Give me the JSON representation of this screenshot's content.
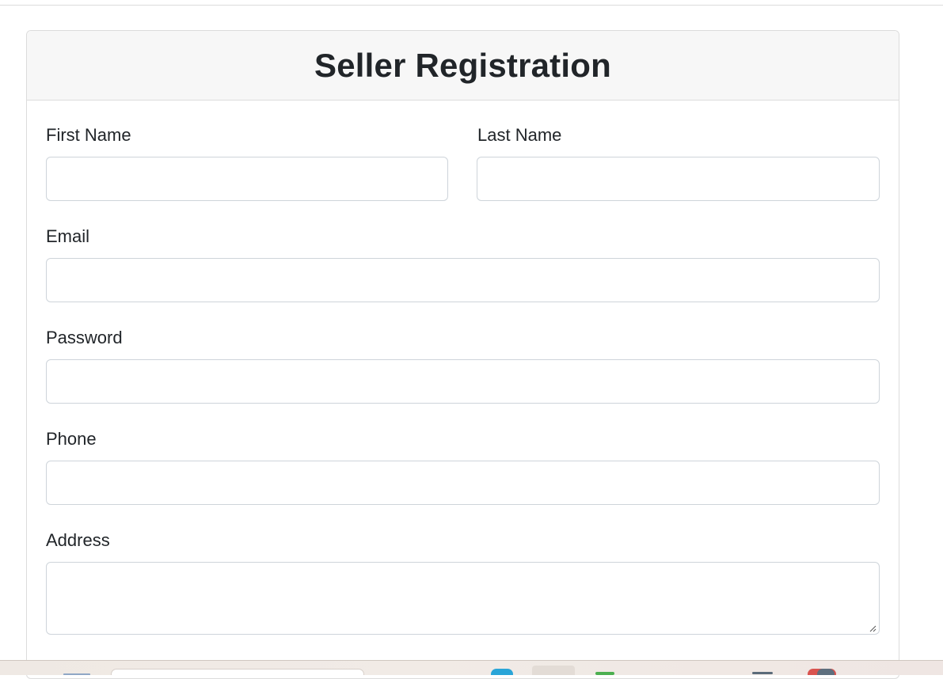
{
  "form": {
    "title": "Seller Registration",
    "fields": {
      "first_name": {
        "label": "First Name",
        "value": "",
        "placeholder": ""
      },
      "last_name": {
        "label": "Last Name",
        "value": "",
        "placeholder": ""
      },
      "email": {
        "label": "Email",
        "value": "",
        "placeholder": ""
      },
      "password": {
        "label": "Password",
        "value": "",
        "placeholder": ""
      },
      "phone": {
        "label": "Phone",
        "value": "",
        "placeholder": ""
      },
      "address": {
        "label": "Address",
        "value": "",
        "placeholder": ""
      }
    }
  },
  "colors": {
    "header_bg": "#f7f7f7",
    "border": "#dcdcdc",
    "input_border": "#ced4da",
    "text": "#212529"
  }
}
